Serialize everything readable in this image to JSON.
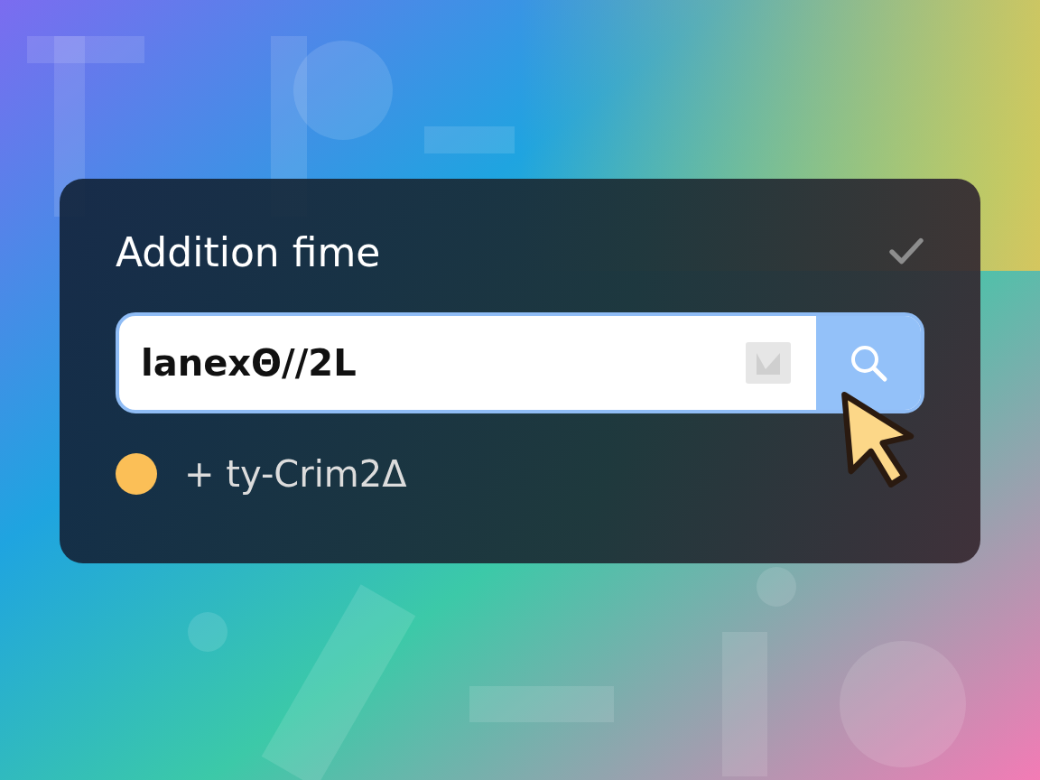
{
  "card": {
    "title": "Addition fime"
  },
  "search": {
    "value": "lanexΘ//2L"
  },
  "status": {
    "label": "+ ty-Crim2Δ",
    "color": "#fbbf57"
  }
}
